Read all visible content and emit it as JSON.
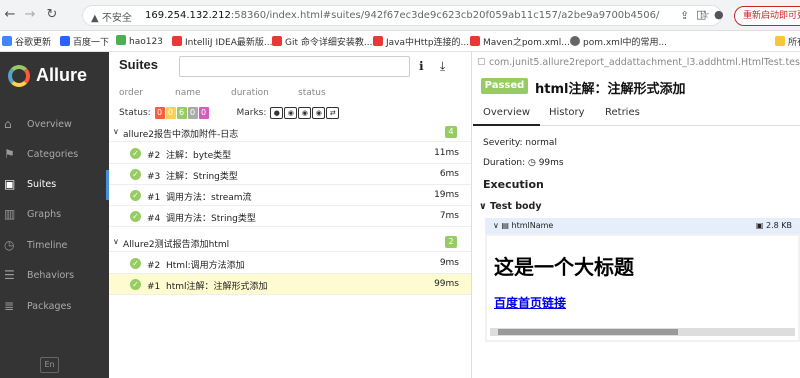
{
  "browser": {
    "warning": "▲ 不安全",
    "url_host": "169.254.132.212",
    "url_rest": ":58360/index.html#suites/942f67ec3de9c623cb20f059ab11c157/a2be9a9700b4506/",
    "restart_label": "重新启动即可更新",
    "bookmarks": [
      "谷歌更新",
      "百度一下",
      "hao123",
      "IntelliJ IDEA最新版...",
      "Git 命令详细安装教...",
      "Java中Http连接的...",
      "Maven之pom.xml...",
      "pom.xml中的常用...",
      "所有"
    ]
  },
  "sidebar": {
    "logo": "Allure",
    "items": [
      {
        "label": "Overview",
        "icon": "home-icon"
      },
      {
        "label": "Categories",
        "icon": "flag-icon"
      },
      {
        "label": "Suites",
        "icon": "briefcase-icon"
      },
      {
        "label": "Graphs",
        "icon": "bar-chart-icon"
      },
      {
        "label": "Timeline",
        "icon": "clock-icon"
      },
      {
        "label": "Behaviors",
        "icon": "list-icon"
      },
      {
        "label": "Packages",
        "icon": "stack-icon"
      }
    ],
    "lang": "En"
  },
  "suites": {
    "title": "Suites",
    "columns": {
      "order": "order",
      "name": "name",
      "duration": "duration",
      "status": "status"
    },
    "status_label": "Status:",
    "status_counts": [
      {
        "value": "0",
        "color": "#fd5a3e"
      },
      {
        "value": "0",
        "color": "#ffd050"
      },
      {
        "value": "6",
        "color": "#97cc64"
      },
      {
        "value": "0",
        "color": "#aaaaaa"
      },
      {
        "value": "0",
        "color": "#d35ebe"
      }
    ],
    "marks_label": "Marks:",
    "groups": [
      {
        "name": "allure2报告中添加附件-日志",
        "count": "4",
        "rows": [
          {
            "order": "#2",
            "name": "注解：byte类型",
            "duration": "11ms"
          },
          {
            "order": "#3",
            "name": "注解：String类型",
            "duration": "6ms"
          },
          {
            "order": "#1",
            "name": "调用方法：stream流",
            "duration": "19ms"
          },
          {
            "order": "#4",
            "name": "调用方法：String类型",
            "duration": "7ms"
          }
        ]
      },
      {
        "name": "Allure2测试报告添加html",
        "count": "2",
        "rows": [
          {
            "order": "#2",
            "name": "Html:调用方法添加",
            "duration": "9ms"
          },
          {
            "order": "#1",
            "name": "html注解：注解形式添加",
            "duration": "99ms"
          }
        ]
      }
    ]
  },
  "detail": {
    "crumb": "com.junit5.allure2report_addattachment_l3.addhtml.HtmlTest.testAd",
    "status": "Passed",
    "title": "html注解：注解形式添加",
    "tabs": [
      "Overview",
      "History",
      "Retries"
    ],
    "severity": "Severity: normal",
    "duration": "Duration: ◷ 99ms",
    "execution": "Execution",
    "test_body": "Test body",
    "attachment_name": "htmlName",
    "attachment_size": "2.8 KB",
    "html_heading": "这是一个大标题",
    "html_link": "百度首页链接"
  }
}
